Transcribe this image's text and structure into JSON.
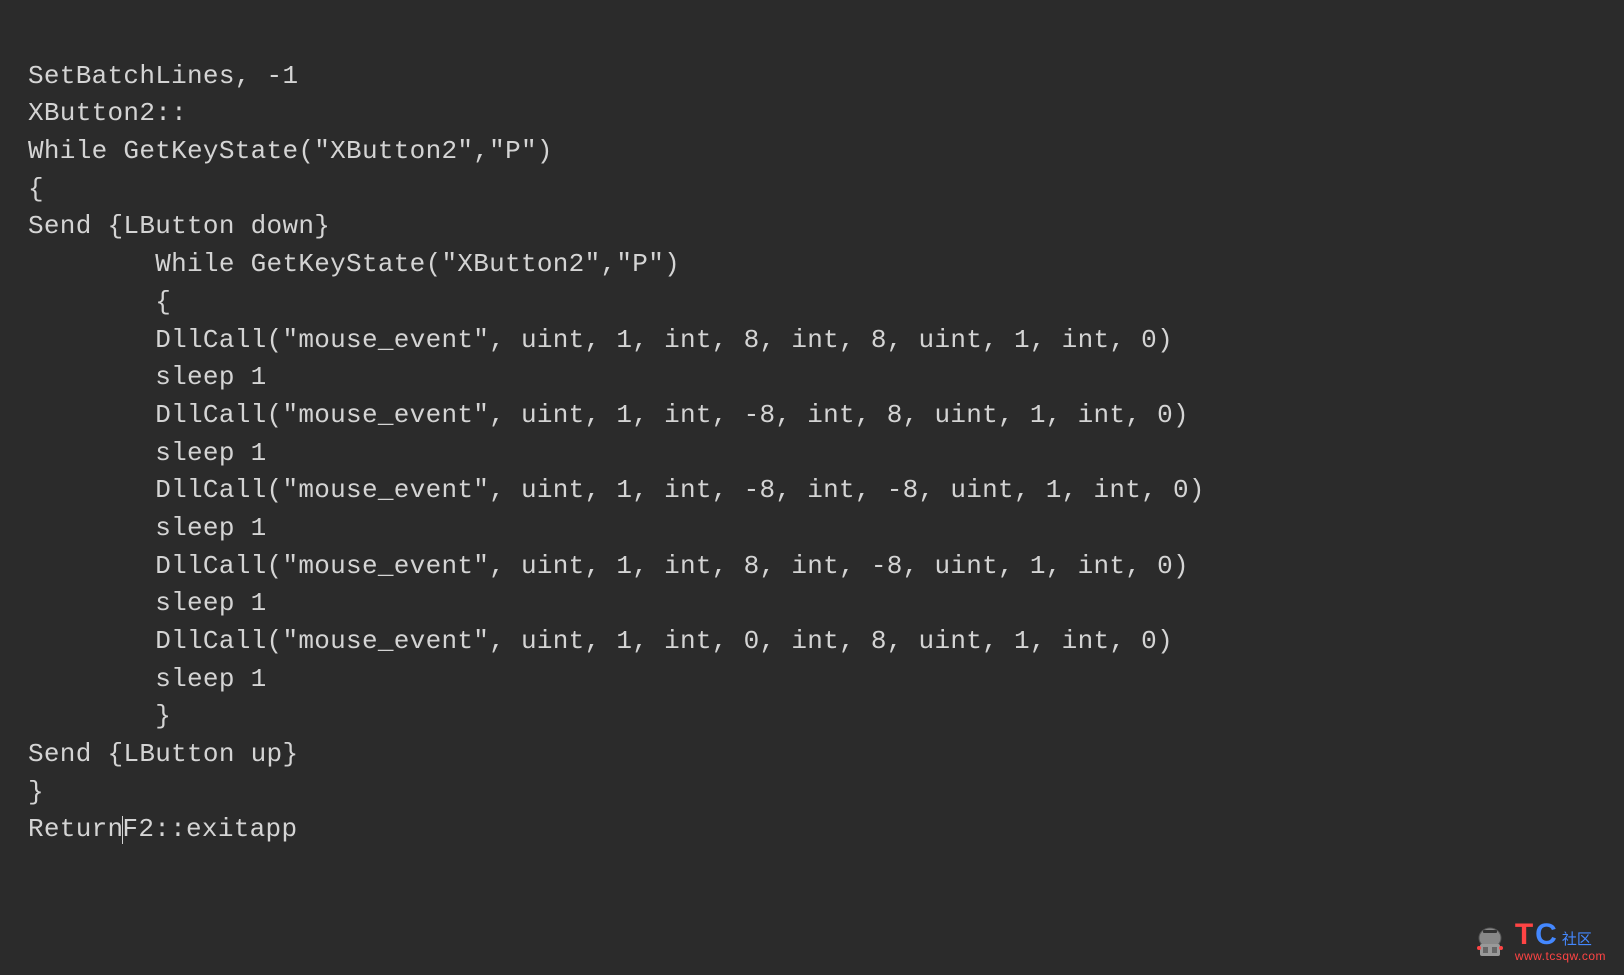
{
  "code": {
    "line1": "SetBatchLines, -1",
    "line2": "XButton2::",
    "line3": "While GetKeyState(\"XButton2\",\"P\")",
    "line4": "{",
    "line5": "Send {LButton down}",
    "line6": "        While GetKeyState(\"XButton2\",\"P\")",
    "line7": "        {",
    "line8": "        DllCall(\"mouse_event\", uint, 1, int, 8, int, 8, uint, 1, int, 0)",
    "line9": "        sleep 1",
    "line10": "        DllCall(\"mouse_event\", uint, 1, int, -8, int, 8, uint, 1, int, 0)",
    "line11": "        sleep 1",
    "line12": "        DllCall(\"mouse_event\", uint, 1, int, -8, int, -8, uint, 1, int, 0)",
    "line13": "        sleep 1",
    "line14": "        DllCall(\"mouse_event\", uint, 1, int, 8, int, -8, uint, 1, int, 0)",
    "line15": "        sleep 1",
    "line16": "        DllCall(\"mouse_event\", uint, 1, int, 0, int, 8, uint, 1, int, 0)",
    "line17": "        sleep 1",
    "line18": "        }",
    "line19": "Send {LButton up}",
    "line20": "}",
    "line21a": "Return",
    "line21b": "F2::exitapp"
  },
  "watermark": {
    "t": "T",
    "c": "C",
    "cn": "社区",
    "url": "www.tcsqw.com"
  }
}
